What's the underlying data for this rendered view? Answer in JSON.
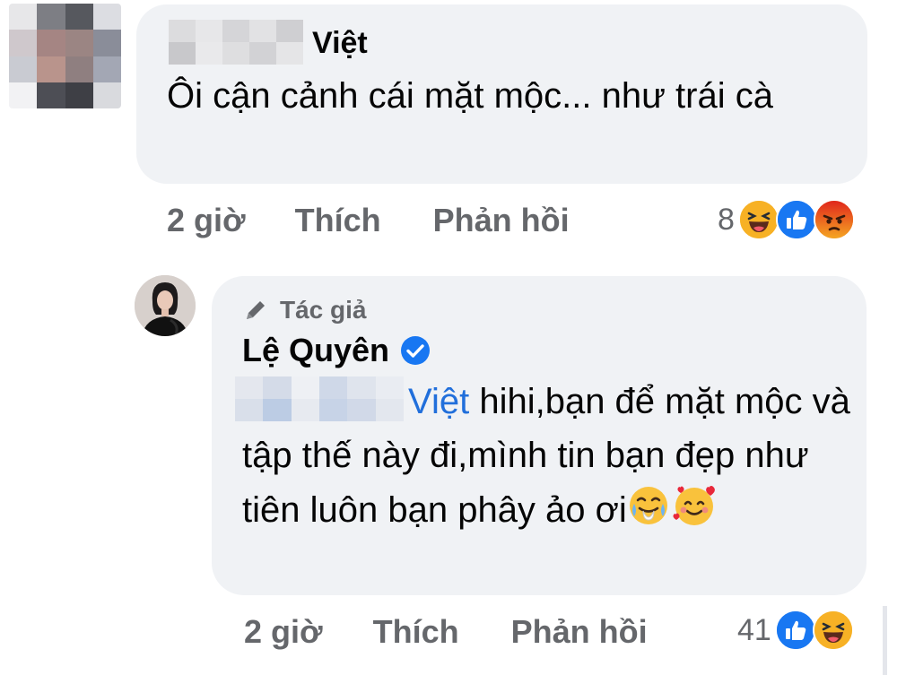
{
  "comment": {
    "author_suffix": "Việt",
    "text": "Ôi cận cảnh cái mặt mộc... như trái cà",
    "actions": {
      "time": "2 giờ",
      "like": "Thích",
      "reply": "Phản hồi"
    },
    "reaction_count": "8",
    "reactions": [
      "haha-icon",
      "like-icon",
      "angry-icon"
    ]
  },
  "reply": {
    "badge": "Tác giả",
    "author": "Lệ Quyên",
    "mention_suffix": "Việt",
    "text": " hihi,bạn để mặt mộc và tập thế này đi,mình tin bạn đẹp như tiên luôn bạn phây ảo ơi",
    "actions": {
      "time": "2 giờ",
      "like": "Thích",
      "reply": "Phản hồi"
    },
    "reaction_count": "41",
    "reactions": [
      "like-icon",
      "haha-icon"
    ]
  },
  "colors": {
    "bubble": "#f0f2f5",
    "meta_text": "#65676b",
    "mention": "#216fdb",
    "like_blue": "#1877f2",
    "haha_yellow": "#f7b125",
    "angry_orange": "#e9710f"
  }
}
